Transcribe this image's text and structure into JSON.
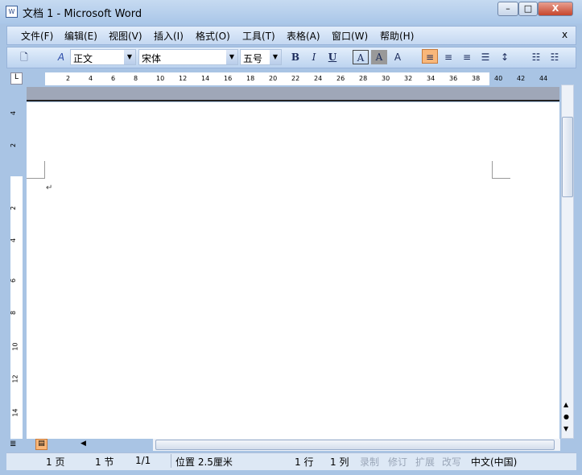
{
  "window": {
    "title": "文档 1 - Microsoft Word",
    "app_icon": "W",
    "minimize": "–",
    "maximize": "□",
    "close": "X"
  },
  "menu": {
    "items": [
      "文件(F)",
      "编辑(E)",
      "视图(V)",
      "插入(I)",
      "格式(O)",
      "工具(T)",
      "表格(A)",
      "窗口(W)",
      "帮助(H)"
    ],
    "close": "x"
  },
  "toolbar": {
    "style": "正文",
    "font": "宋体",
    "size": "五号",
    "bold": "B",
    "italic": "I",
    "underline": "U",
    "char_border": "A",
    "char_shading": "A",
    "scale": "A"
  },
  "ruler": {
    "h_ticks": [
      "2",
      "4",
      "6",
      "8",
      "10",
      "12",
      "14",
      "16",
      "18",
      "20",
      "22",
      "24",
      "26",
      "28",
      "30",
      "32",
      "34",
      "36",
      "38",
      "40",
      "42",
      "44"
    ],
    "v_ticks": [
      "4",
      "2",
      "2",
      "4",
      "6",
      "8",
      "10",
      "12",
      "14"
    ],
    "tab_stop": "L"
  },
  "document": {
    "paragraph_mark": "↵"
  },
  "status": {
    "page": "1 页",
    "section": "1 节",
    "pages": "1/1",
    "position": "位置 2.5厘米",
    "line": "1 行",
    "column": "1 列",
    "rec": "录制",
    "trk": "修订",
    "ext": "扩展",
    "ovr": "改写",
    "language": "中文(中国)"
  },
  "colors": {
    "chrome": "#c4d8f1",
    "active_align": "#f9b77a"
  }
}
